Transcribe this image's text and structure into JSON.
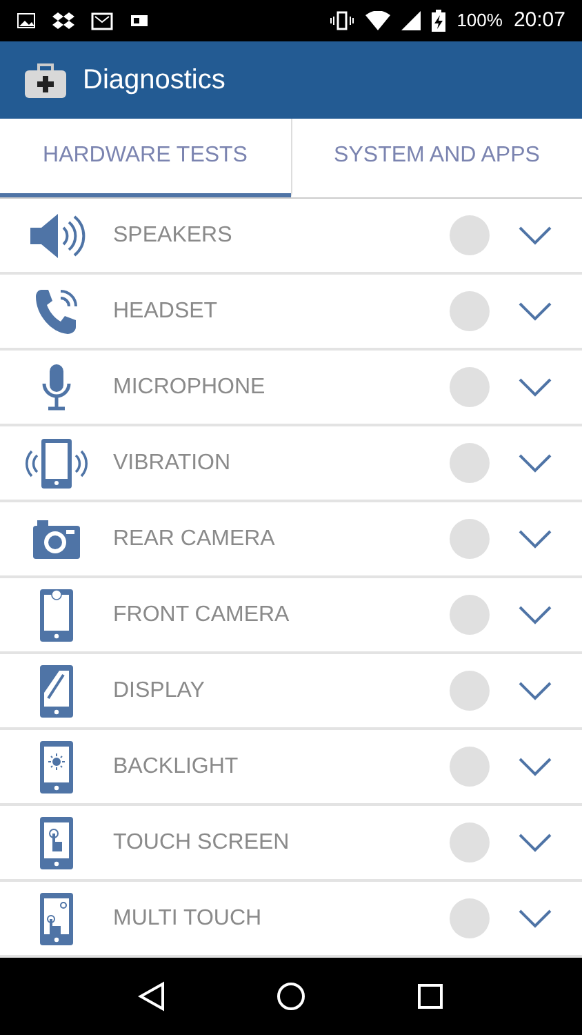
{
  "status_bar": {
    "battery": "100%",
    "time": "20:07"
  },
  "app_bar": {
    "title": "Diagnostics"
  },
  "tabs": [
    {
      "label": "HARDWARE TESTS",
      "selected": true
    },
    {
      "label": "SYSTEM AND APPS",
      "selected": false
    }
  ],
  "tests": [
    {
      "label": "SPEAKERS"
    },
    {
      "label": "HEADSET"
    },
    {
      "label": "MICROPHONE"
    },
    {
      "label": "VIBRATION"
    },
    {
      "label": "REAR CAMERA"
    },
    {
      "label": "FRONT CAMERA"
    },
    {
      "label": "DISPLAY"
    },
    {
      "label": "BACKLIGHT"
    },
    {
      "label": "TOUCH SCREEN"
    },
    {
      "label": "MULTI TOUCH"
    }
  ]
}
